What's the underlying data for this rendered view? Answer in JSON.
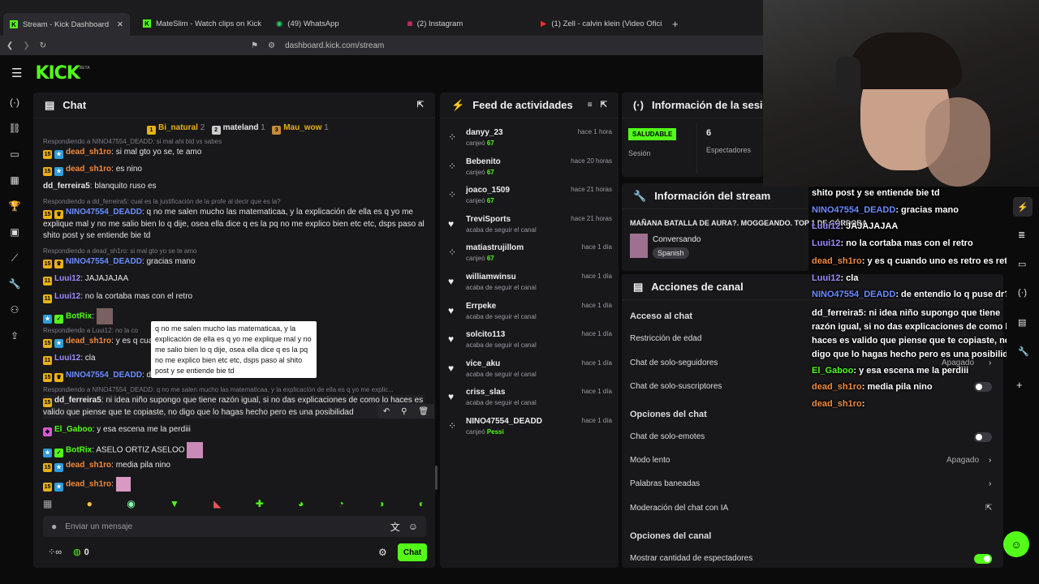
{
  "browser": {
    "tabs": [
      {
        "label": "Stream - Kick Dashboard",
        "icon": "kick-icon"
      },
      {
        "label": "MateSlim - Watch clips on Kick",
        "icon": "kick-icon"
      },
      {
        "label": "(49) WhatsApp",
        "icon": "whatsapp-icon"
      },
      {
        "label": "(2) Instagram",
        "icon": "instagram-icon"
      },
      {
        "label": "(1) Zell - calvin klein (Video Oficial) -",
        "icon": "youtube-icon"
      }
    ],
    "url": "dashboard.kick.com/stream"
  },
  "topnav": {
    "logo": "KICK",
    "beta": "BETA"
  },
  "chat": {
    "title": "Chat",
    "leaders": [
      {
        "name": "Bi_natural",
        "count": "2",
        "rank": "1"
      },
      {
        "name": "mateland",
        "count": "1",
        "rank": "2"
      },
      {
        "name": "Mau_wow",
        "count": "1",
        "rank": "3"
      }
    ],
    "messages": [
      {
        "reply": "Respondiendo a NINO47554_DEADD: si mal ahi bld vs sabes",
        "user": "dead_sh1ro",
        "text": ": si mal gto yo se, te amo"
      },
      {
        "user": "dead_sh1ro",
        "text": ": es nino"
      },
      {
        "user": "dd_ferreira5",
        "text": ": blanquito ruso es"
      },
      {
        "reply": "Respondiendo a dd_ferreira5: cual es la justificación de la profe al decir que es la?",
        "user": "NINO47554_DEADD",
        "text": ": q no me salen mucho las matematicaa, y la explicación de ella es q yo me explique mal y no me salio bien lo q dije, osea ella dice q es la pq no me explico bien etc etc, dsps paso al shito post y se entiende bie td"
      },
      {
        "reply": "Respondiendo a dead_sh1ro: si mal gto yo se te amo",
        "user": "NINO47554_DEADD",
        "text": ": gracias mano"
      },
      {
        "user": "Luui12",
        "text": ": JAJAJAJAA"
      },
      {
        "user": "Luui12",
        "text": ": no la cortaba mas con el retro"
      },
      {
        "user": "BotRix",
        "text": ":"
      },
      {
        "reply": "Respondiendo a Luui12: no la co",
        "user": "dead_sh1ro",
        "text": ": y es q cua"
      },
      {
        "user": "Luui12",
        "text": ": cla"
      },
      {
        "user": "NINO47554_DEADD",
        "text": ": d"
      },
      {
        "reply": "Respondiendo a NINO47554_DEADD: q no me salen mucho las matematicaa, y la explicación de ella es q yo me explic...",
        "user": "dd_ferreira5",
        "text": ": ni idea niño supongo que tiene razón igual, si no das explicaciones de como lo haces es valido que piense que te copiaste, no digo que lo hagas hecho pero es una posibilidad"
      },
      {
        "user": "El_Gaboo",
        "text": ": y esa escena me la perdiii"
      },
      {
        "user": "BotRix",
        "text": ": ASELO ORTIZ ASELOO"
      },
      {
        "user": "dead_sh1ro",
        "text": ": media pila nino"
      },
      {
        "user": "dead_sh1ro",
        "text": ":"
      }
    ],
    "tooltip": "q no me salen mucho las matematicaa, y la explicación de ella es q yo me explique mal y no me salio bien lo q dije, osea ella dice q es la pq no me explico bien etc etc, dsps paso al shito post y se entiende bie td",
    "input_placeholder": "Enviar un mensaje",
    "points": "0",
    "send": "Chat"
  },
  "feed": {
    "title": "Feed de actividades",
    "items": [
      {
        "name": "danyy_23",
        "sub": "canjeó",
        "val": "67",
        "time": "hace 1 hora",
        "icon": "redeem-icon"
      },
      {
        "name": "Bebenito",
        "sub": "canjeó",
        "val": "67",
        "time": "hace 20 horas",
        "icon": "redeem-icon"
      },
      {
        "name": "joaco_1509",
        "sub": "canjeó",
        "val": "67",
        "time": "hace 21 horas",
        "icon": "redeem-icon"
      },
      {
        "name": "TreviSports",
        "sub": "acaba de seguir el canal",
        "val": "",
        "time": "hace 21 horas",
        "icon": "heart-icon"
      },
      {
        "name": "matiastrujillom",
        "sub": "canjeó",
        "val": "67",
        "time": "hace 1 día",
        "icon": "redeem-icon"
      },
      {
        "name": "williamwinsu",
        "sub": "acaba de seguir el canal",
        "val": "",
        "time": "hace 1 día",
        "icon": "heart-icon"
      },
      {
        "name": "Errpeke",
        "sub": "acaba de seguir el canal",
        "val": "",
        "time": "hace 1 día",
        "icon": "heart-icon"
      },
      {
        "name": "solcito113",
        "sub": "acaba de seguir el canal",
        "val": "",
        "time": "hace 1 día",
        "icon": "heart-icon"
      },
      {
        "name": "vice_aku",
        "sub": "acaba de seguir el canal",
        "val": "",
        "time": "hace 1 día",
        "icon": "heart-icon"
      },
      {
        "name": "criss_slas",
        "sub": "acaba de seguir el canal",
        "val": "",
        "time": "hace 1 día",
        "icon": "heart-icon"
      },
      {
        "name": "NINO47554_DEADD",
        "sub": "canjeó",
        "val": "Pessi",
        "time": "hace 1 día",
        "icon": "redeem-icon"
      }
    ]
  },
  "session": {
    "title": "Información de la sesión",
    "status": "SALUDABLE",
    "status_label": "Sesión",
    "viewers": "6",
    "viewers_label": "Espectadores"
  },
  "streaminfo": {
    "title": "Información del stream",
    "stream_title": "MAÑANA BATALLA DE AURA?. MOGGEANDO. TOP 1 DE CÓRDOBA",
    "category": "Conversando",
    "language": "Spanish"
  },
  "actions": {
    "title": "Acciones de canal",
    "chat_access": "Acceso al chat",
    "age": "Restricción de edad",
    "followers": "Chat de solo-seguidores",
    "subs": "Chat de solo-suscriptores",
    "chat_options": "Opciones del chat",
    "emotes": "Chat de solo-emotes",
    "slow": "Modo lento",
    "slow_value": "Apagado",
    "banned": "Palabras baneadas",
    "ai": "Moderación del chat con IA",
    "channel_options": "Opciones del canal",
    "show_viewers": "Mostrar cantidad de espectadores",
    "followers_value": "Apagado"
  },
  "overlay": [
    {
      "user": "",
      "text": "shito post y se entiende bie td"
    },
    {
      "user": "NINO47554_DEADD",
      "text": ": gracias mano"
    },
    {
      "user": "Luui12",
      "text": ": JAJAJAJAA"
    },
    {
      "user": "Luui12",
      "text": ": no la cortaba mas con el retro"
    },
    {
      "user": "dead_sh1ro",
      "text": ": y es q cuando uno es retro es retro"
    },
    {
      "user": "Luui12",
      "text": ": cla"
    },
    {
      "user": "NINO47554_DEADD",
      "text": ": de entendio lo q puse dr?"
    },
    {
      "user": "dd_ferreira5",
      "text": ": ni idea niño supongo que tiene razón igual, si no das explicaciones de como lo haces es valido que piense que te copiaste, no digo que lo hagas hecho pero es una posibilidad"
    },
    {
      "user": "El_Gaboo",
      "text": ": y esa escena me la perdiii"
    },
    {
      "user": "dead_sh1ro",
      "text": ": media pila nino"
    },
    {
      "user": "dead_sh1ro",
      "text": ":"
    }
  ],
  "colors": {
    "accent": "#53fc18",
    "panel": "#18181b",
    "bg": "#0b0b0c"
  }
}
